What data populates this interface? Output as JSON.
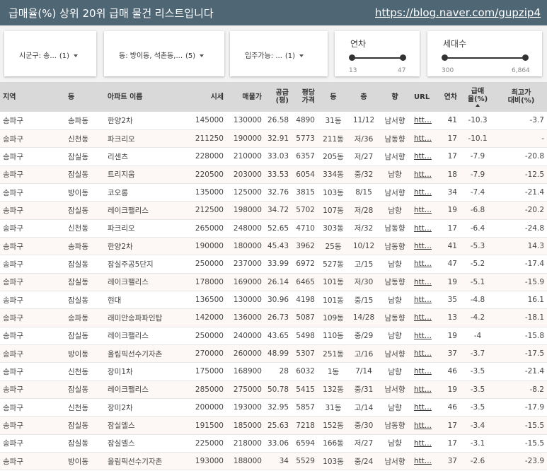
{
  "header": {
    "title": "급매율(%) 상위 20위 급매 물건 리스트입니다",
    "url": "https://blog.naver.com/gupzip4"
  },
  "filters": {
    "sigungu": {
      "label": "시군구: 송...",
      "count": "(1)"
    },
    "dong": {
      "label": "동: 방이동, 석촌동,...",
      "count": "(5)"
    },
    "move_in": {
      "label": "입주가능: ...",
      "count": "(1)"
    },
    "year": {
      "label": "연차",
      "min": "13",
      "max": "47"
    },
    "households": {
      "label": "세대수",
      "min": "300",
      "max": "6,864"
    }
  },
  "table": {
    "columns": [
      "지역",
      "동",
      "아파트 이름",
      "시세",
      "매물가",
      "공급\n(평)",
      "평당\n가격",
      "동",
      "층",
      "향",
      "URL",
      "연차",
      "급매\n율(%)",
      "최고가\n대비(%)"
    ],
    "rows": [
      [
        "송파구",
        "송파동",
        "한양2차",
        "145000",
        "130000",
        "26.58",
        "4890",
        "31동",
        "11/12",
        "남서향",
        "htt...",
        "41",
        "-10.3",
        "-3.7"
      ],
      [
        "송파구",
        "신천동",
        "파크리오",
        "211250",
        "190000",
        "32.91",
        "5773",
        "211동",
        "저/36",
        "남동향",
        "htt...",
        "17",
        "-10.1",
        "-"
      ],
      [
        "송파구",
        "잠실동",
        "리센츠",
        "228000",
        "210000",
        "33.03",
        "6357",
        "205동",
        "저/27",
        "남서향",
        "htt...",
        "17",
        "-7.9",
        "-20.8"
      ],
      [
        "송파구",
        "잠실동",
        "트리지움",
        "220500",
        "203000",
        "33.53",
        "6054",
        "334동",
        "중/32",
        "남향",
        "htt...",
        "18",
        "-7.9",
        "-12.5"
      ],
      [
        "송파구",
        "방이동",
        "코오롱",
        "135000",
        "125000",
        "32.76",
        "3815",
        "103동",
        "8/15",
        "남서향",
        "htt...",
        "34",
        "-7.4",
        "-21.4"
      ],
      [
        "송파구",
        "잠실동",
        "레이크팰리스",
        "212500",
        "198000",
        "34.72",
        "5702",
        "107동",
        "저/28",
        "남향",
        "htt...",
        "19",
        "-6.8",
        "-20.2"
      ],
      [
        "송파구",
        "신천동",
        "파크리오",
        "265000",
        "248000",
        "52.65",
        "4710",
        "303동",
        "저/32",
        "남동향",
        "htt...",
        "17",
        "-6.4",
        "-24.8"
      ],
      [
        "송파구",
        "송파동",
        "한양2차",
        "190000",
        "180000",
        "45.43",
        "3962",
        "25동",
        "10/12",
        "남동향",
        "htt...",
        "41",
        "-5.3",
        "14.3"
      ],
      [
        "송파구",
        "잠실동",
        "잠실주공5단지",
        "250000",
        "237000",
        "33.99",
        "6972",
        "527동",
        "고/15",
        "남향",
        "htt...",
        "47",
        "-5.2",
        "-17.4"
      ],
      [
        "송파구",
        "잠실동",
        "레이크팰리스",
        "178000",
        "169000",
        "26.14",
        "6465",
        "101동",
        "저/30",
        "남동향",
        "htt...",
        "19",
        "-5.1",
        "-15.9"
      ],
      [
        "송파구",
        "잠실동",
        "현대",
        "136500",
        "130000",
        "30.96",
        "4198",
        "101동",
        "중/15",
        "남향",
        "htt...",
        "35",
        "-4.8",
        "16.1"
      ],
      [
        "송파구",
        "송파동",
        "래미안송파파인탑",
        "142000",
        "136000",
        "26.73",
        "5087",
        "109동",
        "14/28",
        "남동향",
        "htt...",
        "13",
        "-4.2",
        "-18.1"
      ],
      [
        "송파구",
        "잠실동",
        "레이크팰리스",
        "250000",
        "240000",
        "43.65",
        "5498",
        "110동",
        "중/29",
        "남향",
        "htt...",
        "19",
        "-4",
        "-15.8"
      ],
      [
        "송파구",
        "방이동",
        "올림픽선수기자촌",
        "270000",
        "260000",
        "48.99",
        "5307",
        "251동",
        "고/16",
        "남서향",
        "htt...",
        "37",
        "-3.7",
        "-17.5"
      ],
      [
        "송파구",
        "신천동",
        "장미1차",
        "175000",
        "168900",
        "28",
        "6032",
        "1동",
        "7/14",
        "남향",
        "htt...",
        "46",
        "-3.5",
        "-21.4"
      ],
      [
        "송파구",
        "잠실동",
        "레이크팰리스",
        "285000",
        "275000",
        "50.78",
        "5415",
        "132동",
        "중/31",
        "남서향",
        "htt...",
        "19",
        "-3.5",
        "-8.2"
      ],
      [
        "송파구",
        "신천동",
        "장미2차",
        "200000",
        "193000",
        "32.95",
        "5857",
        "31동",
        "고/14",
        "남향",
        "htt...",
        "46",
        "-3.5",
        "-17.9"
      ],
      [
        "송파구",
        "잠실동",
        "잠실엘스",
        "191500",
        "185000",
        "25.63",
        "7218",
        "152동",
        "중/30",
        "남동향",
        "htt...",
        "17",
        "-3.4",
        "-15.5"
      ],
      [
        "송파구",
        "잠실동",
        "잠실엘스",
        "225000",
        "218000",
        "33.06",
        "6594",
        "166동",
        "저/27",
        "남향",
        "htt...",
        "17",
        "-3.1",
        "-15.5"
      ],
      [
        "송파구",
        "방이동",
        "올림픽선수기자촌",
        "193000",
        "188000",
        "34",
        "5529",
        "103동",
        "중/24",
        "남서향",
        "htt...",
        "37",
        "-2.6",
        "-23.9"
      ]
    ]
  }
}
